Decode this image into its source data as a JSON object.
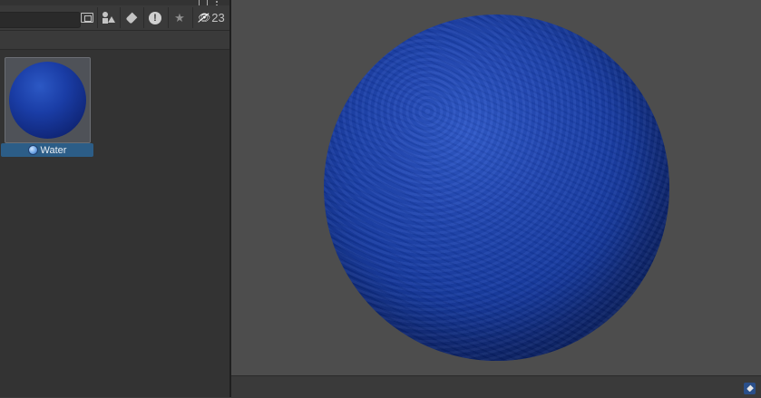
{
  "project_panel": {
    "search": {
      "value": "",
      "placeholder": ""
    },
    "toolbar": {
      "create_window_icon": "window-icon",
      "filter_by_type_icon": "shapes-icon",
      "filter_by_label_icon": "tag-icon",
      "warning_glyph": "!",
      "favorite_glyph": "★",
      "hidden_icon": "eye-slash-icon",
      "hidden_glyph": "👁",
      "hidden_count": "23"
    },
    "assets": [
      {
        "name": "Water",
        "type_icon": "material-icon"
      }
    ]
  },
  "preview": {
    "labels_icon": "tag-icon"
  },
  "colors": {
    "selection": "#2c5d87",
    "material_blue": "#1e44b0"
  }
}
